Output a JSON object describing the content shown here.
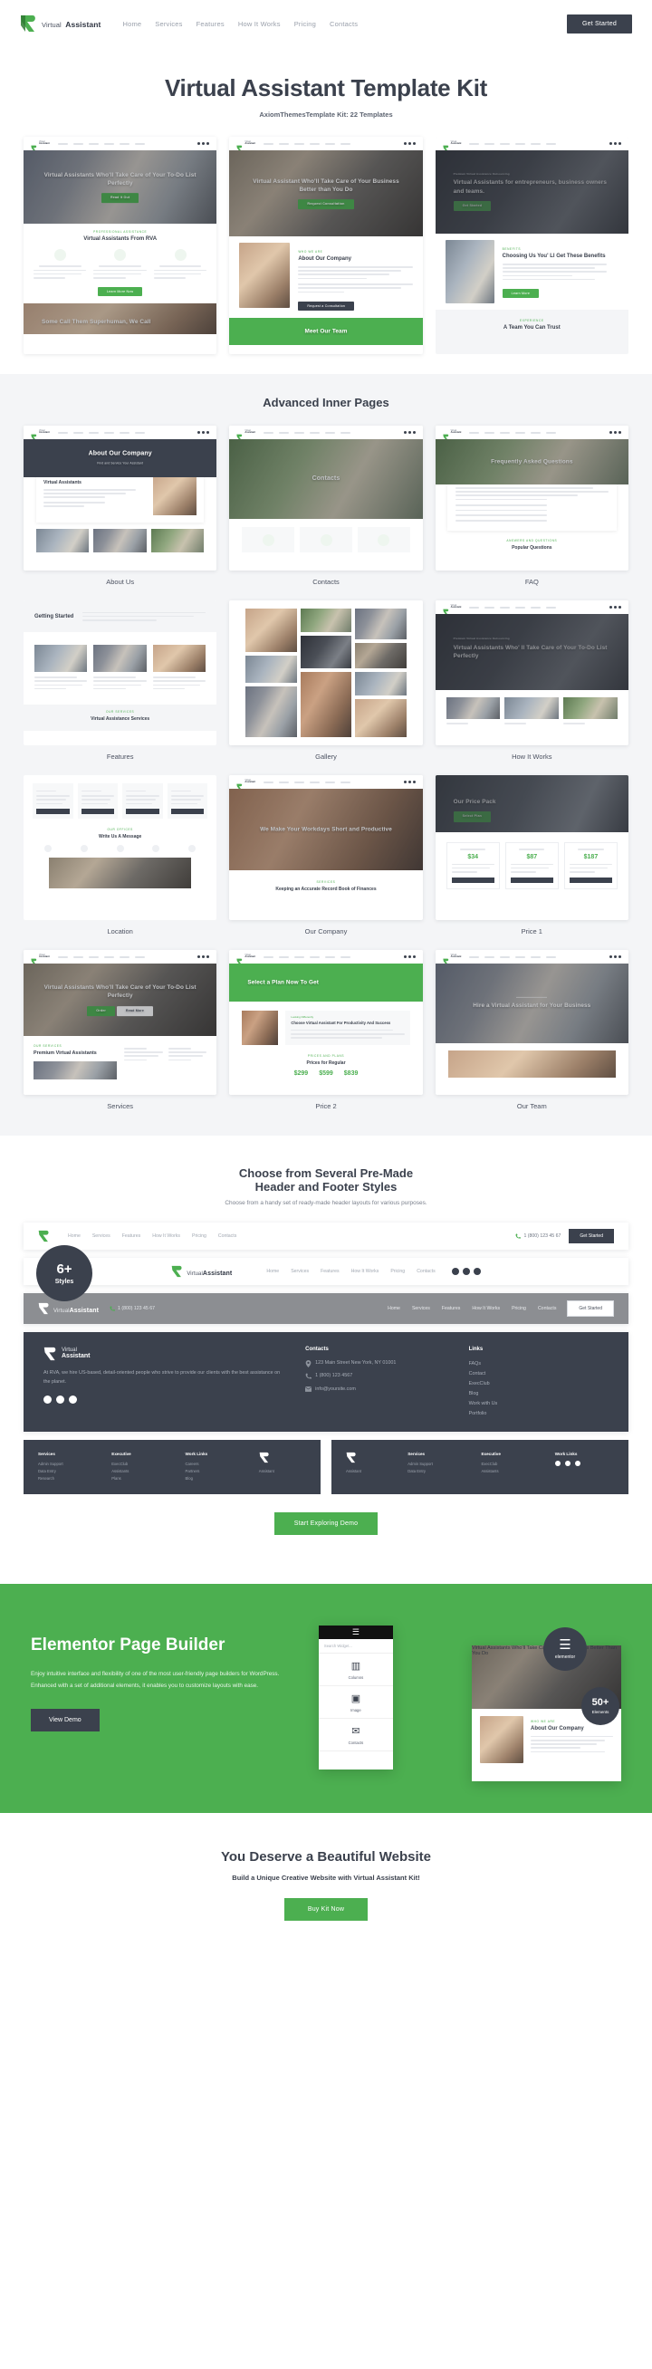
{
  "brand": {
    "line1": "Virtual",
    "line2": "Assistant",
    "accent": "#4caf50",
    "dark": "#3b414d"
  },
  "topbar": {
    "nav": [
      "Home",
      "Services",
      "Features",
      "How It Works",
      "Pricing",
      "Contacts"
    ],
    "cta_label": "Get Started"
  },
  "hero": {
    "title": "Virtual Assistant Template Kit",
    "subtitle": "AxiomThemesTemplate Kit: 22 Templates"
  },
  "home_demos": [
    {
      "caption": "Virtual Assistants Who'll Take Care of Your To-Do List Perfectly",
      "button": "Read It Out",
      "section_kicker": "Professional Assistance",
      "section_title": "Virtual Assistants From RVA",
      "section_button": "Learn More Now",
      "bottom_caption": "Some Call Them Superhuman, We Call"
    },
    {
      "caption": "Virtual Assistant Who'll Take Care of Your Business Better than You Do",
      "button": "Request Consultation",
      "section_kicker": "Who We Are",
      "section_title": "About Our Company",
      "section_button": "Request a Consultation",
      "bottom_caption": "Meet Our Team"
    },
    {
      "caption": "Virtual Assistants for entrepreneurs, business owners and teams.",
      "button": "Get Started",
      "section_kicker": "Benefits",
      "section_title": "Choosing Us You' Ll Get These Benefits",
      "section_button": "Learn More",
      "bottom_caption": "A Team You Can Trust"
    }
  ],
  "inner": {
    "title": "Advanced Inner Pages",
    "cards": [
      {
        "label": "About Us",
        "caption": "About Our Company",
        "sub": "Find and Service Your Assistant",
        "kicker": "Services",
        "inner_title": "Virtual Assistants"
      },
      {
        "label": "Contacts",
        "caption": "Contacts",
        "sub": "",
        "kicker": "",
        "inner_title": ""
      },
      {
        "label": "FAQ",
        "caption": "Frequently Asked Questions",
        "sub": "",
        "kicker": "Answers and Questions",
        "inner_title": "Popular Questions"
      },
      {
        "label": "Features",
        "caption": "Getting Started",
        "sub": "",
        "kicker": "Our Services",
        "inner_title": "Virtual Assistance Services"
      },
      {
        "label": "Gallery",
        "caption": "",
        "sub": "",
        "kicker": "",
        "inner_title": ""
      },
      {
        "label": "How It Works",
        "caption": "Virtual Assistants Who' ll Take Care of Your To-Do List Perfectly",
        "sub": "",
        "kicker": "Premium Virtual Assistance Outsourcing",
        "inner_title": ""
      },
      {
        "label": "Location",
        "caption": "",
        "sub": "",
        "kicker": "Our Offices",
        "inner_title": "Write Us A Message"
      },
      {
        "label": "Our Company",
        "caption": "We Make Your Workdays Short and Productive",
        "sub": "",
        "kicker": "Services",
        "inner_title": "Keeping an Accurate Record Book of Finances"
      },
      {
        "label": "Price 1",
        "caption": "Our Price Pack",
        "sub": "",
        "kicker": "",
        "inner_title": "",
        "prices": [
          "$34",
          "$87",
          "$187"
        ]
      },
      {
        "label": "Services",
        "caption": "Virtual Assistants Who'll Take Care of Your To-Do List Perfectly",
        "sub": "",
        "kicker": "Our Services",
        "inner_title": "Premium Virtual Assistants"
      },
      {
        "label": "Price 2",
        "caption": "Select a Plan Now To Get",
        "sub": "",
        "kicker": "Prices and Plans",
        "inner_title": "Prices for Regular",
        "prices": [
          "$299",
          "$599",
          "$839"
        ],
        "block_title": "Choose Virtual Assistant For Productivity And Success"
      },
      {
        "label": "Our Team",
        "caption": "Hire a Virtual Assistant for Your Business",
        "sub": "",
        "kicker": "",
        "inner_title": ""
      }
    ]
  },
  "headers": {
    "title_line1": "Choose from Several Pre-Made",
    "title_line2": "Header and Footer Styles",
    "subtitle": "Choose from a handy set of ready-made header layouts for various purposes.",
    "badge_number": "6+",
    "badge_label": "Styles",
    "nav": [
      "Home",
      "Services",
      "Features",
      "How It Works",
      "Pricing",
      "Contacts"
    ],
    "phone": "1 (800) 123 45 67",
    "cta_label": "Get Started",
    "explore_button": "Start Exploring Demo"
  },
  "footer": {
    "about": "At RVA, we hire US-based, detail-oriented people who strive to provide our clients with the best assistance on the planet.",
    "contacts_heading": "Contacts",
    "address": "123 Main Street New York, NY 01001",
    "phone": "1 (800) 123 4567",
    "email": "info@yoursite.com",
    "links_heading": "Links",
    "links": [
      "FAQs",
      "Contact",
      "ExecClub",
      "Blog",
      "Work with Us",
      "Portfolio"
    ],
    "mini_columns": [
      {
        "heading": "Services",
        "items": [
          "Admin Support",
          "Data Entry",
          "Research"
        ]
      },
      {
        "heading": "Executive",
        "items": [
          "ExecClub",
          "Assistants",
          "Plans"
        ]
      },
      {
        "heading": "Work Links",
        "items": [
          "Careers",
          "Partners",
          "Blog"
        ]
      }
    ]
  },
  "elementor": {
    "title": "Elementor Page Builder",
    "body": "Enjoy intuitive interface and flexibility of one of the most user-friendly page builders for WordPress. Enhanced with a set of additional elements, it enables you to customize layouts with ease.",
    "button": "View Demo",
    "panel_brand": "elementor",
    "search_placeholder": "Search Widget...",
    "widgets": [
      {
        "icon": "columns-icon",
        "glyph": "▥",
        "name": "Columns"
      },
      {
        "icon": "image-icon",
        "glyph": "▣",
        "name": "Image"
      },
      {
        "icon": "contacts-icon",
        "glyph": "✉",
        "name": "Contacts"
      }
    ],
    "badge_label": "elementor",
    "count_number": "50+",
    "count_label": "Elements",
    "preview_caption": "Virtual Assistants Who'll Take Care of Your Business Better Than You Do",
    "preview_title": "About Our Company"
  },
  "bottom": {
    "title": "You Deserve a Beautiful Website",
    "subtitle": "Build a Unique Creative Website with Virtual Assistant Kit!",
    "button": "Buy Kit Now"
  }
}
